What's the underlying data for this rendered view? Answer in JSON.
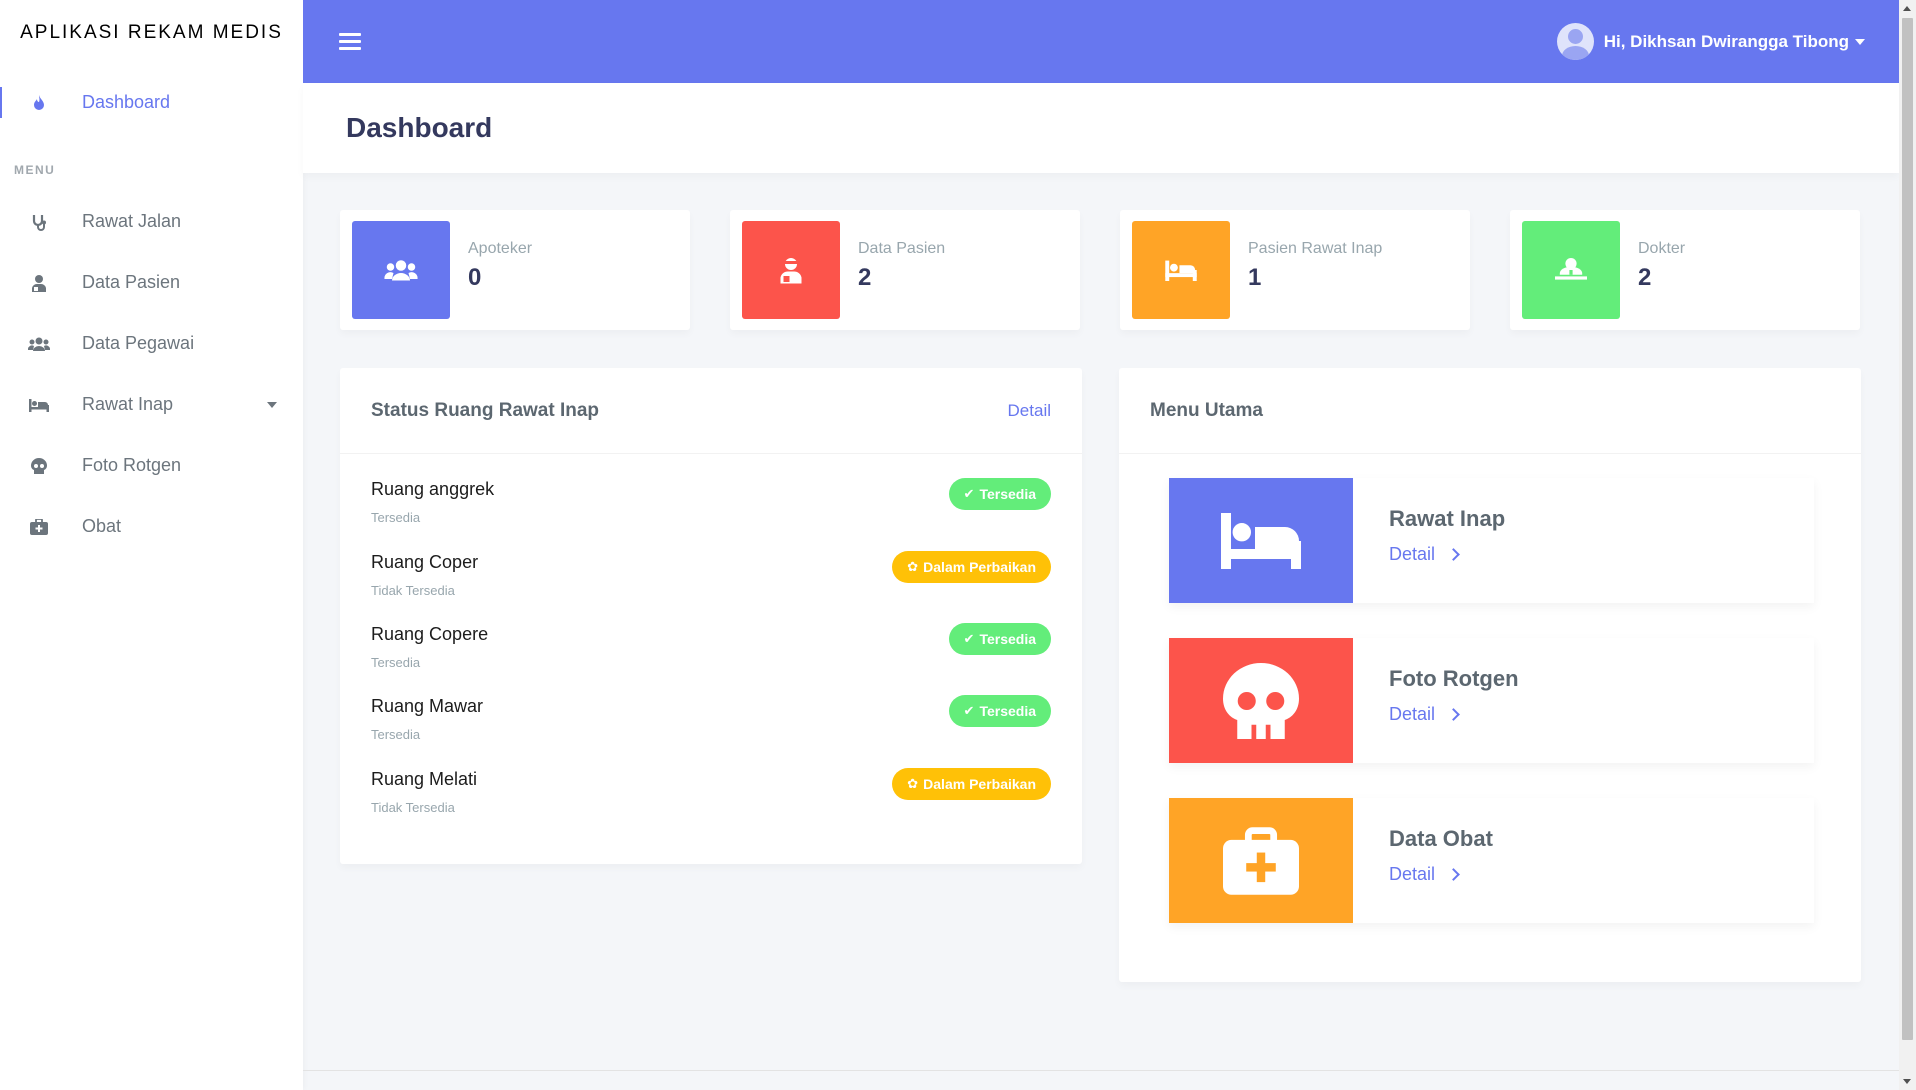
{
  "brand": "APLIKASI REKAM MEDIS",
  "sidebar": {
    "dashboard": "Dashboard",
    "menu_header": "MENU",
    "items": [
      {
        "label": "Rawat Jalan",
        "icon": "stethoscope-icon"
      },
      {
        "label": "Data Pasien",
        "icon": "user-injured-icon"
      },
      {
        "label": "Data Pegawai",
        "icon": "users-icon"
      },
      {
        "label": "Rawat Inap",
        "icon": "bed-icon"
      },
      {
        "label": "Foto Rotgen",
        "icon": "skull-icon"
      },
      {
        "label": "Obat",
        "icon": "medkit-icon"
      }
    ]
  },
  "navbar": {
    "user": "Hi, Dikhsan Dwirangga Tibong"
  },
  "page_title": "Dashboard",
  "stats": [
    {
      "label": "Apoteker",
      "value": "0",
      "color": "#6777ef",
      "icon": "users-icon"
    },
    {
      "label": "Data Pasien",
      "value": "2",
      "color": "#fc544b",
      "icon": "user-injured-icon"
    },
    {
      "label": "Pasien Rawat Inap",
      "value": "1",
      "color": "#ffa426",
      "icon": "bed-icon"
    },
    {
      "label": "Dokter",
      "value": "2",
      "color": "#63ed7a",
      "icon": "user-md-icon"
    }
  ],
  "rooms": {
    "title": "Status Ruang Rawat Inap",
    "detail": "Detail",
    "list": [
      {
        "name": "Ruang anggrek",
        "status": "Tersedia",
        "badge": "Tersedia"
      },
      {
        "name": "Ruang Coper",
        "status": "Tidak Tersedia",
        "badge": "Dalam Perbaikan"
      },
      {
        "name": "Ruang Copere",
        "status": "Tersedia",
        "badge": "Tersedia"
      },
      {
        "name": "Ruang Mawar",
        "status": "Tersedia",
        "badge": "Tersedia"
      },
      {
        "name": "Ruang Melati",
        "status": "Tidak Tersedia",
        "badge": "Dalam Perbaikan"
      }
    ]
  },
  "menu_utama": {
    "title": "Menu Utama",
    "tiles": [
      {
        "title": "Rawat Inap",
        "link": "Detail",
        "color": "#6777ef",
        "icon": "bed-icon"
      },
      {
        "title": "Foto Rotgen",
        "link": "Detail",
        "color": "#fc544b",
        "icon": "skull-icon"
      },
      {
        "title": "Data Obat",
        "link": "Detail",
        "color": "#ffa426",
        "icon": "medkit-icon"
      }
    ]
  }
}
